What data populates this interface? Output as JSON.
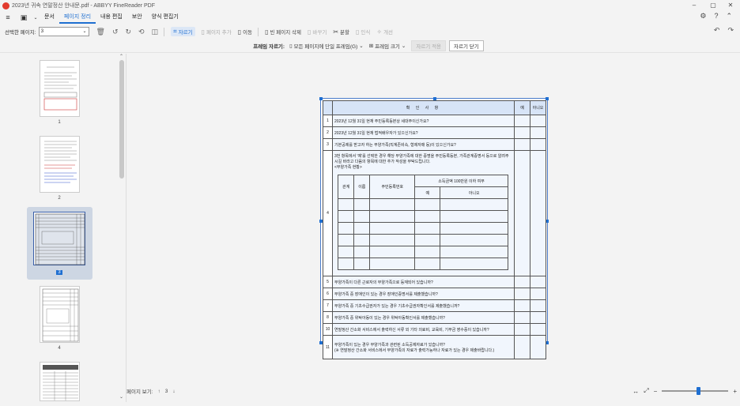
{
  "window": {
    "title": "2023년 귀속 연말정산 안내문.pdf - ABBYY FineReader PDF"
  },
  "menu": {
    "items": [
      "문서",
      "페이지 정리",
      "내용 편집",
      "보안",
      "양식 편집기"
    ],
    "active_index": 1
  },
  "toolbar": {
    "page_label": "선택한 페이지:",
    "page_value": "3",
    "crop": "자르기",
    "add_page": "페이지 추가",
    "move": "이동",
    "delete_blank": "빈 페이지 삭제",
    "replace": "바꾸기",
    "split": "분할",
    "recognize": "인식",
    "improve": "개선"
  },
  "cropbar": {
    "label": "프레임 자르기:",
    "apply_all": "모든 페이지에 단일 프레임(G)",
    "frame_size": "프레임 크기",
    "apply": "자르기 적용",
    "close": "자르기 닫기"
  },
  "thumbnails": {
    "labels": [
      "1",
      "2",
      "3",
      "4"
    ],
    "selected": "3"
  },
  "footer": {
    "page_view_label": "페이지 보기:",
    "page_number": "3"
  },
  "zoom": {
    "level_fraction": 0.55
  },
  "document": {
    "header": {
      "title": "확 인 사 항",
      "yes": "예",
      "no": "아니오"
    },
    "questions": [
      {
        "no": "1",
        "text": "2023년 12월 31일 현재 주민등록등본상 세대주이신가요?"
      },
      {
        "no": "2",
        "text": "2023년 12월 31일 현재 법적배우자가 있으신가요?"
      },
      {
        "no": "3",
        "text": "기본공제를 받고자 하는 부양가족(직계존비속, 형제자매 등)이 있으신가요?"
      },
      {
        "no": "4",
        "text": "3번 항목에서 '예'를 선택한 경우 해당 부양가족에 대한 증명을 주민등록등본, 가족관계증명서 등으로 알려주시길 바라고 다음의 항목에 대한 추가 작성을 부탁드립니다.",
        "subtitle": "<부양가족 현황>"
      },
      {
        "no": "5",
        "text": "부양가족이 다른 근로자의 부양가족으로 등재되어 있습니까?"
      },
      {
        "no": "6",
        "text": "부양가족 중 장애인이 있는 경우 장애인증명서를 제출했습니까?"
      },
      {
        "no": "7",
        "text": "부양가족 중 기초수급권자가 있는 경우 기초수급권자확인서를 제출했습니까?"
      },
      {
        "no": "8",
        "text": "부양가족 중 위탁아동이 있는 경우 위탁아동확인서를 제출했습니까?"
      },
      {
        "no": "10",
        "text": "연말정산 간소화 서비스에서 출력하신 서류 외 기타 의료비, 교육비, 기부금 영수증이 있습니까?"
      },
      {
        "no": "11",
        "text": "부양가족이 있는 경우 부양가족과 관련된 소득공제자료가 있습니까?",
        "note": "(※ 연말정산 간소화 서비스에서 부양가족의 자료가 출력가능하나 자료가 있는 경우 제출바랍니다.)"
      }
    ],
    "dependents": {
      "headers": [
        "관계",
        "이름",
        "주민등록번호",
        "소득금액 100만원 이하 여부"
      ],
      "sub_headers": [
        "예",
        "아니오"
      ]
    }
  }
}
